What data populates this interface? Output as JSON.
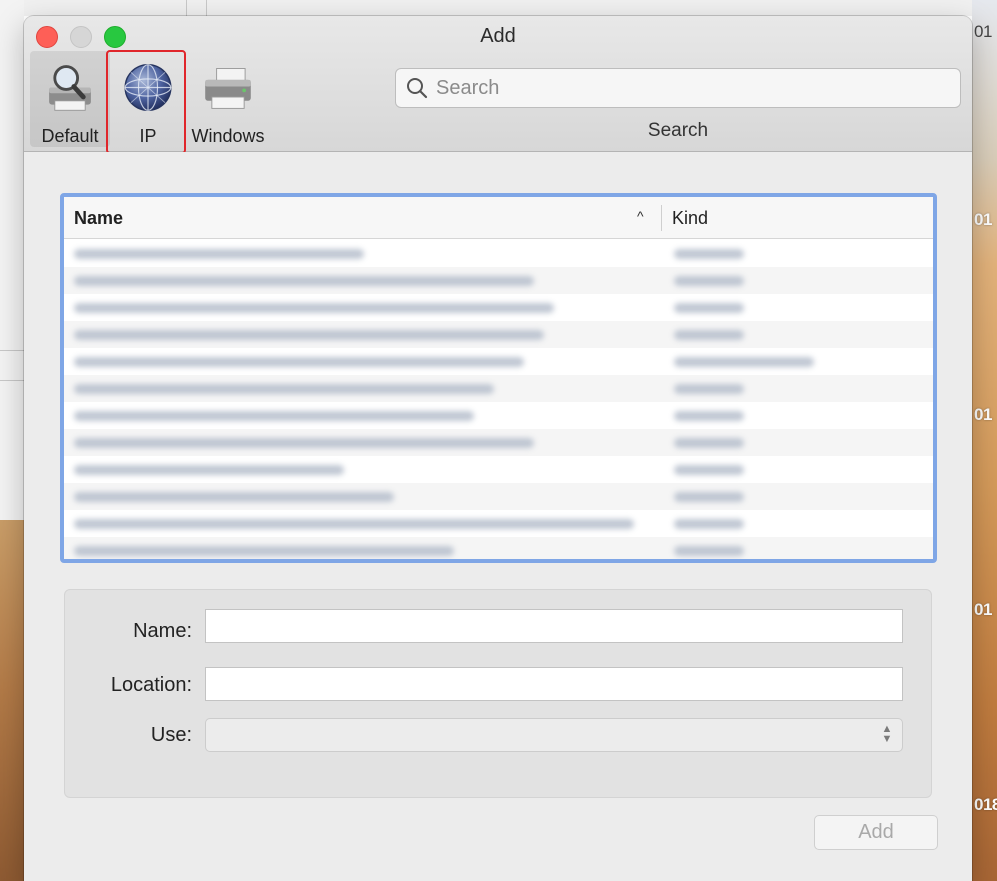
{
  "window": {
    "title": "Add",
    "toolbar": {
      "items": [
        {
          "label": "Default",
          "icon": "printer-search-icon"
        },
        {
          "label": "IP",
          "icon": "globe-network-icon"
        },
        {
          "label": "Windows",
          "icon": "printer-icon"
        }
      ],
      "search": {
        "placeholder": "Search",
        "caption": "Search"
      }
    }
  },
  "printer_list": {
    "columns": {
      "name": "Name",
      "kind": "Kind",
      "sort_indicator": "^"
    }
  },
  "form": {
    "name_label": "Name:",
    "name_value": "",
    "location_label": "Location:",
    "location_value": "",
    "use_label": "Use:",
    "use_value": ""
  },
  "add_button": "Add",
  "desktop_labels": [
    "01",
    "01",
    "01",
    "01",
    "018"
  ],
  "colors": {
    "list_focus_ring": "#7fa6e6",
    "highlight_box": "#e0262b",
    "close_button": "#fe5f57",
    "zoom_button": "#28c840"
  }
}
